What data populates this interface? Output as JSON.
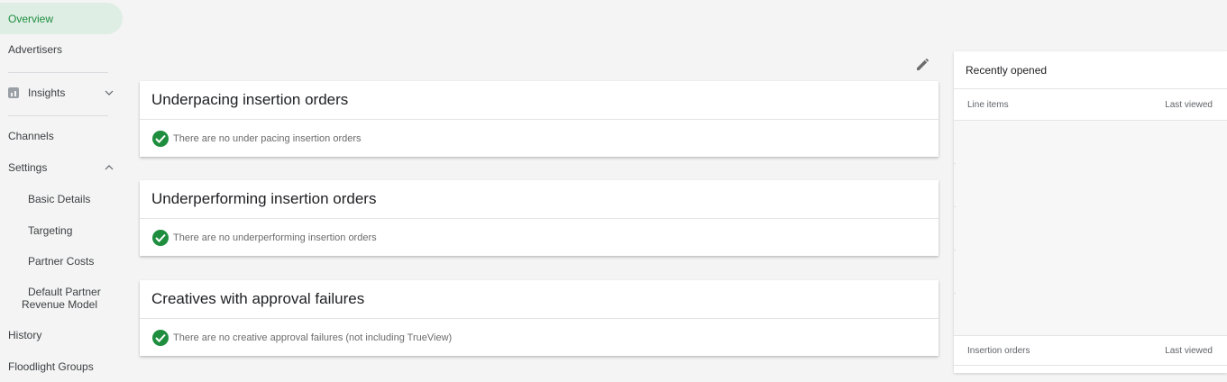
{
  "sidebar": {
    "items": [
      {
        "label": "Overview"
      },
      {
        "label": "Advertisers"
      },
      {
        "label": "Insights"
      },
      {
        "label": "Channels"
      },
      {
        "label": "Settings"
      },
      {
        "label": "Basic Details"
      },
      {
        "label": "Targeting"
      },
      {
        "label": "Partner Costs"
      },
      {
        "label": "Default Partner"
      },
      {
        "label": "Revenue Model"
      },
      {
        "label": "History"
      },
      {
        "label": "Floodlight Groups"
      }
    ]
  },
  "cards": [
    {
      "title": "Underpacing insertion orders",
      "message": "There are no under pacing insertion orders"
    },
    {
      "title": "Underperforming insertion orders",
      "message": "There are no underperforming insertion orders"
    },
    {
      "title": "Creatives with approval failures",
      "message": "There are no creative approval failures (not including TrueView)"
    }
  ],
  "recent": {
    "title": "Recently opened",
    "line_items_header": "Line items",
    "insertion_orders_header": "Insertion orders",
    "last_viewed": "Last viewed"
  },
  "colors": {
    "accent": "#1e8e3e",
    "active_bg": "#dfeee5"
  },
  "icons": [
    "insights-chart-icon",
    "chevron-down-icon",
    "chevron-up-icon",
    "edit-pencil-icon",
    "check-circle-icon"
  ]
}
